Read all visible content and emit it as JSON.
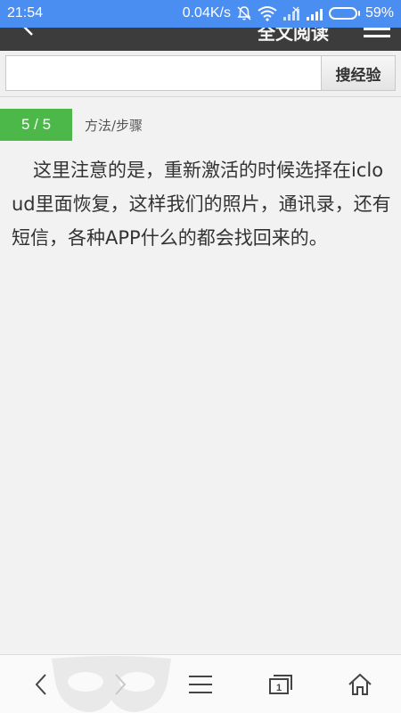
{
  "status_bar": {
    "time": "21:54",
    "network_speed": "0.04K/s",
    "battery_percent": "59%",
    "battery_level": 0.59,
    "icons": [
      "mute-bell-icon",
      "wifi-icon",
      "signal-weak-icon",
      "signal-icon",
      "battery-icon"
    ]
  },
  "header": {
    "title": "全文阅读",
    "back_icon": "chevron-left-icon",
    "menu_icon": "hamburger-icon"
  },
  "search": {
    "input_value": "",
    "button_label": "搜经验"
  },
  "step": {
    "badge": "5 / 5",
    "label": "方法/步骤",
    "text": "这里注意的是，重新激活的时候选择在icloud里面恢复，这样我们的照片，通讯录，还有短信，各种APP什么的都会找回来的。"
  },
  "bottom_nav": {
    "items": [
      "back-arrow-icon",
      "forward-arrow-icon",
      "menu-icon",
      "tabs-icon",
      "home-icon"
    ],
    "tab_count": "1"
  },
  "colors": {
    "status_bar": "#4b8ef2",
    "header": "#3c3c3c",
    "step_badge": "#4cb849",
    "background": "#f2f2f2"
  }
}
